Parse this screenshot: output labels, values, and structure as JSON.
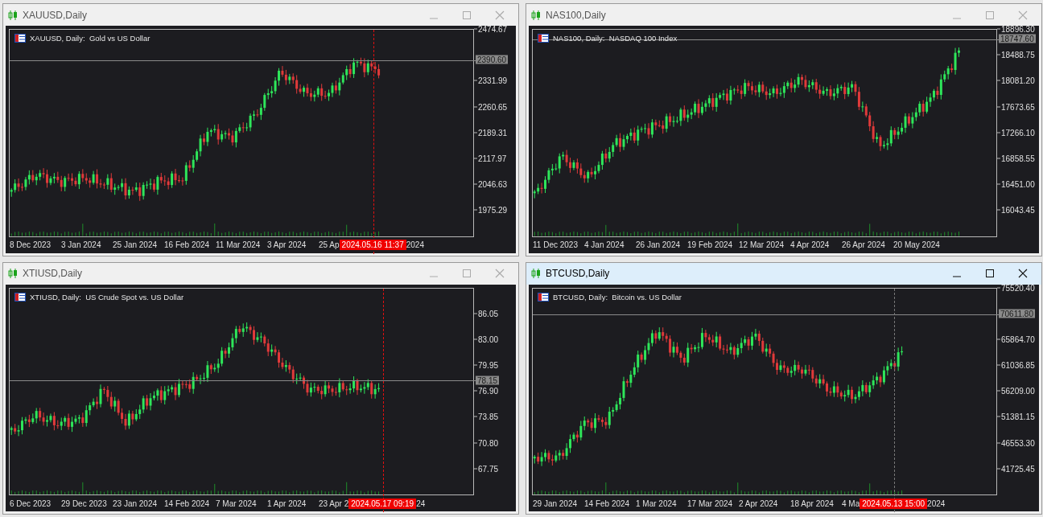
{
  "windows": [
    {
      "title": "XAUUSD,Daily",
      "active": false,
      "legend": "XAUUSD, Daily:  Gold vs US Dollar",
      "price_ticks": [
        "2474.67",
        "2331.99",
        "2260.65",
        "2189.31",
        "2117.97",
        "2046.63",
        "1975.29"
      ],
      "current_price": "2390.60",
      "date_labels": [
        "8 Dec 2023",
        "3 Jan 2024",
        "25 Jan 2024",
        "16 Feb 2024",
        "11 Mar 2024",
        "3 Apr 2024",
        "25 Ap"
      ],
      "crosshair": {
        "time": "2024.05.16  11:37",
        "highlighted": true
      },
      "date_labels_after": [
        "2024"
      ]
    },
    {
      "title": "NAS100,Daily",
      "active": false,
      "legend": "NAS100, Daily:  NASDAQ 100 Index",
      "price_ticks": [
        "18896.30",
        "18488.75",
        "18081.20",
        "17673.65",
        "17266.10",
        "16858.55",
        "16451.00",
        "16043.45"
      ],
      "current_price": "18747.60",
      "date_labels": [
        "11 Dec 2023",
        "4 Jan 2024",
        "26 Jan 2024",
        "19 Feb 2024",
        "12 Mar 2024",
        "4 Apr 2024",
        "26 Apr 2024",
        "20 May 2024"
      ]
    },
    {
      "title": "XTIUSD,Daily",
      "active": false,
      "legend": "XTIUSD, Daily:  US Crude Spot vs. US Dollar",
      "price_ticks": [
        "86.05",
        "83.00",
        "79.95",
        "76.90",
        "73.85",
        "70.80",
        "67.75"
      ],
      "current_price": "78.15",
      "date_labels": [
        "6 Dec 2023",
        "29 Dec 2023",
        "23 Jan 2024",
        "14 Feb 2024",
        "7 Mar 2024",
        "1 Apr 2024",
        "23 Apr 2"
      ],
      "crosshair": {
        "time": "2024.05.17  09:19",
        "highlighted": true
      },
      "date_labels_after": [
        "24"
      ]
    },
    {
      "title": "BTCUSD,Daily",
      "active": true,
      "legend": "BTCUSD, Daily:  Bitcoin vs. US Dollar",
      "price_ticks": [
        "75520.40",
        "65864.70",
        "61036.85",
        "56209.00",
        "51381.15",
        "46553.30",
        "41725.45"
      ],
      "current_price": "70611.80",
      "date_labels": [
        "29 Jan 2024",
        "14 Feb 2024",
        "1 Mar 2024",
        "17 Mar 2024",
        "2 Apr 2024",
        "18 Apr 2024",
        "4 Ma"
      ],
      "crosshair": {
        "time": "2024.05.13  15:00",
        "highlighted": false
      },
      "date_labels_after": [
        "2024"
      ]
    }
  ]
}
